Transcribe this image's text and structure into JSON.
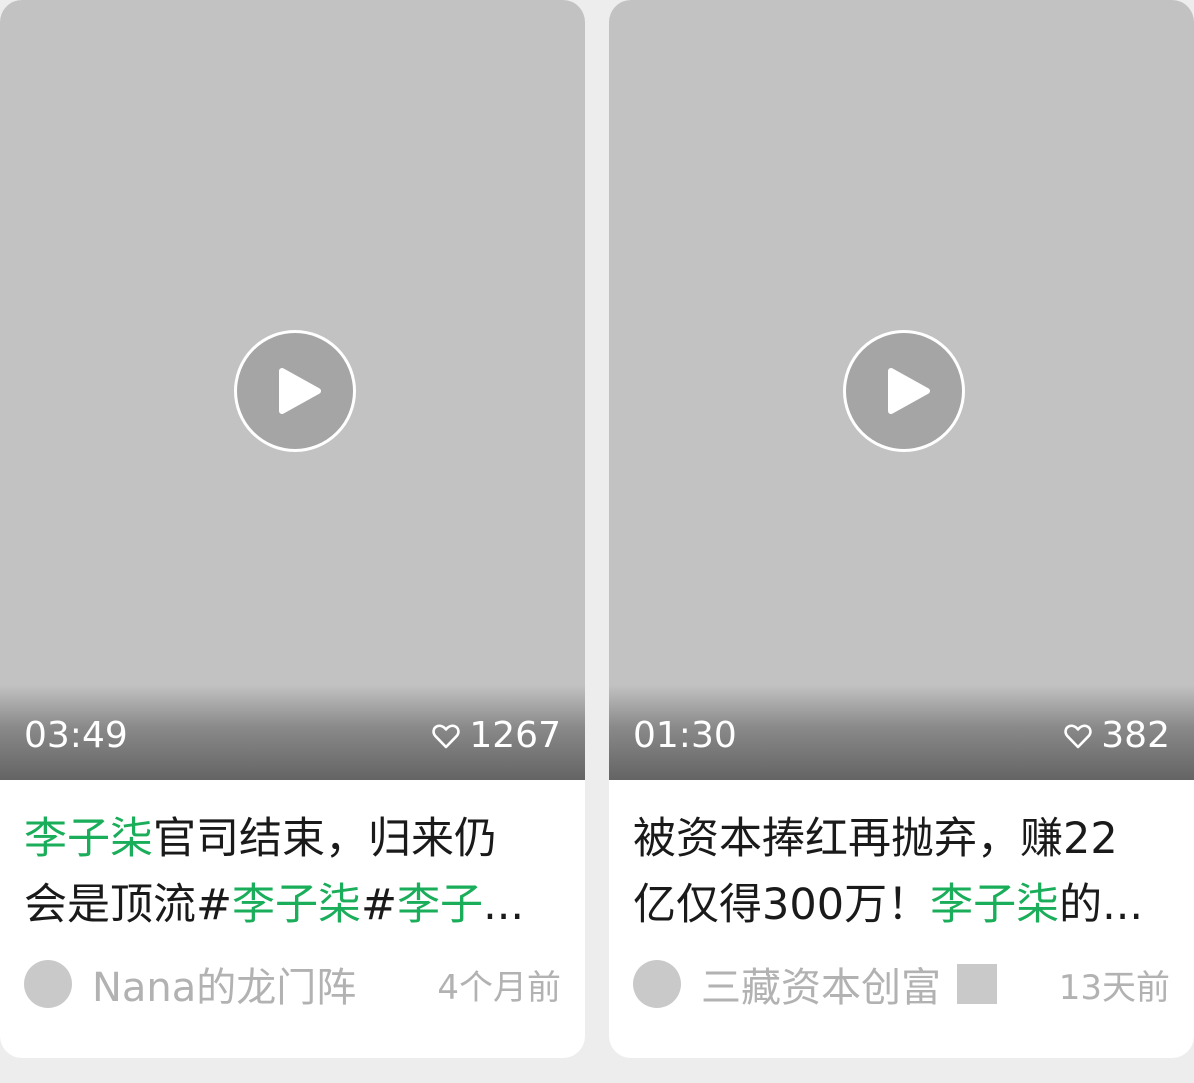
{
  "cards": [
    {
      "duration": "03:49",
      "likes": "1267",
      "title_line1": [
        {
          "text": "李子柒",
          "highlight": true
        },
        {
          "text": "官司结束，归来仍",
          "highlight": false
        }
      ],
      "title_line2": [
        {
          "text": "会是顶流#",
          "highlight": false
        },
        {
          "text": "李子柒",
          "highlight": true
        },
        {
          "text": "#",
          "highlight": false
        },
        {
          "text": "李子",
          "highlight": true
        },
        {
          "text": "...",
          "highlight": false
        }
      ],
      "author": "Nana的龙门阵",
      "time": "4个月前",
      "has_badge": false
    },
    {
      "duration": "01:30",
      "likes": "382",
      "title_line1": [
        {
          "text": "被资本捧红再抛弃，赚22",
          "highlight": false
        }
      ],
      "title_line2": [
        {
          "text": "亿仅得300万！",
          "highlight": false
        },
        {
          "text": "李子柒",
          "highlight": true
        },
        {
          "text": "的...",
          "highlight": false
        }
      ],
      "author": "三藏资本创富",
      "time": "13天前",
      "has_badge": true
    }
  ],
  "icons": {
    "play": "play-icon",
    "heart": "heart-icon",
    "avatar": "avatar",
    "badge": "verified-badge-icon"
  },
  "colors": {
    "highlight": "#1aad5a",
    "thumbnail": "#c2c2c2",
    "meta_text": "#b2b2b2"
  }
}
